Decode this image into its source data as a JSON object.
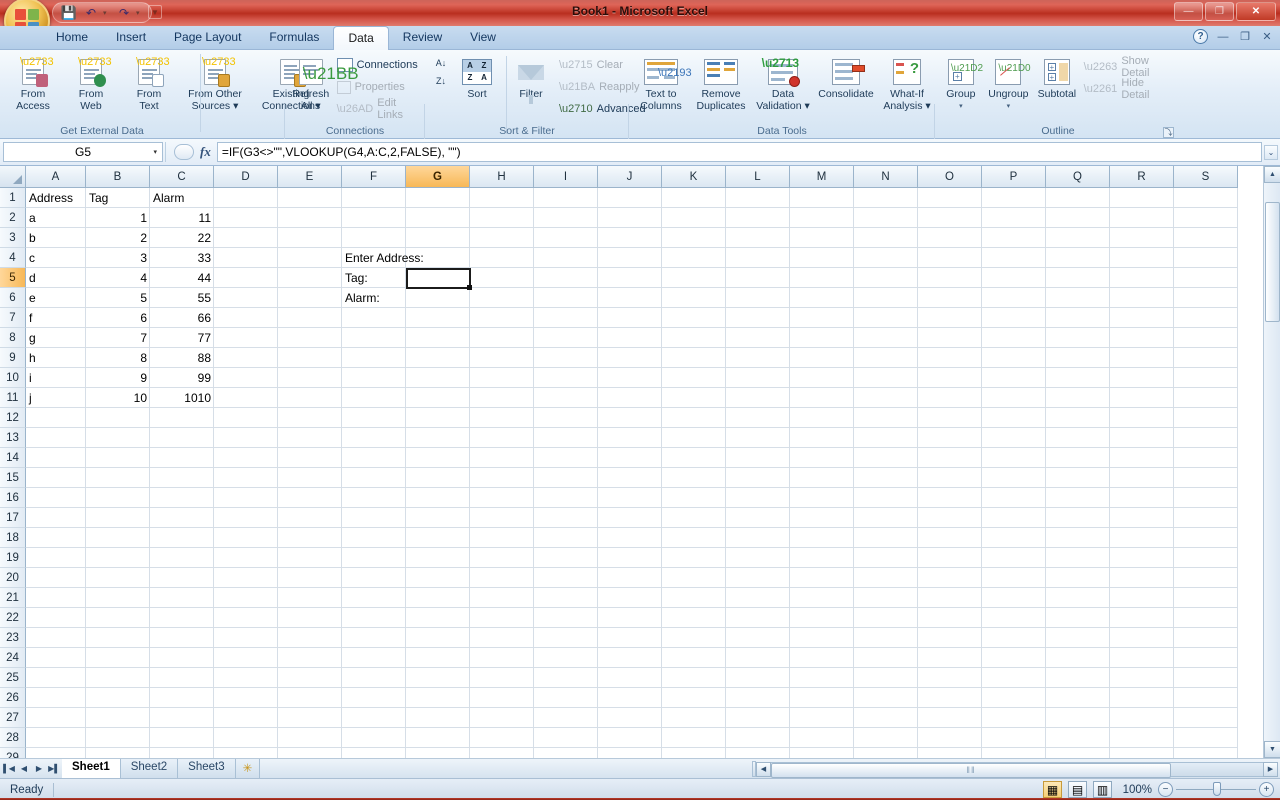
{
  "window": {
    "title": "Book1 - Microsoft Excel",
    "office_button": "office-orb",
    "quick_access": [
      {
        "name": "save",
        "glyph": "💾"
      },
      {
        "name": "undo",
        "glyph": "↶"
      },
      {
        "name": "redo",
        "glyph": "↷"
      }
    ],
    "qat_customize": "▼",
    "controls": {
      "minimize": "—",
      "restore": "❐",
      "close": "✕"
    }
  },
  "ribbon": {
    "tabs": [
      {
        "label": "Home",
        "active": false
      },
      {
        "label": "Insert",
        "active": false
      },
      {
        "label": "Page Layout",
        "active": false
      },
      {
        "label": "Formulas",
        "active": false
      },
      {
        "label": "Data",
        "active": true
      },
      {
        "label": "Review",
        "active": false
      },
      {
        "label": "View",
        "active": false
      }
    ],
    "help_glyph": "?",
    "doc_controls": {
      "minimize": "—",
      "restore": "❐",
      "close": "✕"
    },
    "groups": [
      {
        "name": "Get External Data",
        "label": "Get External Data",
        "buttons": [
          {
            "label_top": "From",
            "label_bottom": "Access"
          },
          {
            "label_top": "From",
            "label_bottom": "Web"
          },
          {
            "label_top": "From",
            "label_bottom": "Text"
          },
          {
            "label_top": "From Other",
            "label_bottom": "Sources ▾"
          }
        ]
      },
      {
        "name": "Existing Connections",
        "label": "",
        "buttons": [
          {
            "label_top": "Existing",
            "label_bottom": "Connections"
          }
        ]
      },
      {
        "name": "Connections",
        "label": "Connections",
        "refresh_top": "Refresh",
        "refresh_bottom": "All ▾",
        "items": [
          {
            "label": "Connections",
            "enabled": true
          },
          {
            "label": "Properties",
            "enabled": false
          },
          {
            "label": "Edit Links",
            "enabled": false
          }
        ]
      },
      {
        "name": "Sort & Filter",
        "label": "Sort & Filter",
        "sort_asc": "A↓",
        "sort_desc": "Z↓",
        "sort_label": "Sort",
        "filter_label": "Filter",
        "items": [
          {
            "label": "Clear",
            "enabled": false
          },
          {
            "label": "Reapply",
            "enabled": false
          },
          {
            "label": "Advanced",
            "enabled": true
          }
        ]
      },
      {
        "name": "Data Tools",
        "label": "Data Tools",
        "buttons": [
          {
            "label_top": "Text to",
            "label_bottom": "Columns"
          },
          {
            "label_top": "Remove",
            "label_bottom": "Duplicates"
          },
          {
            "label_top": "Data",
            "label_bottom": "Validation ▾"
          },
          {
            "label_top": "Consolidate",
            "label_bottom": ""
          },
          {
            "label_top": "What-If",
            "label_bottom": "Analysis ▾"
          }
        ]
      },
      {
        "name": "Outline",
        "label": "Outline",
        "buttons": [
          {
            "label_top": "Group",
            "label_bottom": "▾"
          },
          {
            "label_top": "Ungroup",
            "label_bottom": "▾"
          },
          {
            "label_top": "Subtotal",
            "label_bottom": ""
          }
        ],
        "items": [
          {
            "label": "Show Detail",
            "enabled": false
          },
          {
            "label": "Hide Detail",
            "enabled": false
          }
        ],
        "dialog_launcher": "⤵"
      }
    ]
  },
  "formula_bar": {
    "name_box_value": "G5",
    "name_box_caret": "▾",
    "fx_label": "fx",
    "formula": "=IF(G3<>\"\",VLOOKUP(G4,A:C,2,FALSE), \"\")",
    "expand_glyph": "⌄"
  },
  "grid": {
    "columns": [
      "A",
      "B",
      "C",
      "D",
      "E",
      "F",
      "G",
      "H",
      "I",
      "J",
      "K",
      "L",
      "M",
      "N",
      "O",
      "P",
      "Q",
      "R",
      "S"
    ],
    "selected_column": "G",
    "rows": [
      1,
      2,
      3,
      4,
      5,
      6,
      7,
      8,
      9,
      10,
      11,
      12,
      13,
      14,
      15,
      16,
      17,
      18,
      19,
      20,
      21,
      22,
      23,
      24,
      25,
      26,
      27,
      28,
      29
    ],
    "selected_row": 5,
    "selected_cell": "G5",
    "cells": [
      {
        "col": "A",
        "row": 1,
        "value": "Address",
        "align": "left"
      },
      {
        "col": "B",
        "row": 1,
        "value": "Tag",
        "align": "left"
      },
      {
        "col": "C",
        "row": 1,
        "value": "Alarm",
        "align": "left"
      },
      {
        "col": "A",
        "row": 2,
        "value": "a",
        "align": "left"
      },
      {
        "col": "B",
        "row": 2,
        "value": "1",
        "align": "right"
      },
      {
        "col": "C",
        "row": 2,
        "value": "11",
        "align": "right"
      },
      {
        "col": "A",
        "row": 3,
        "value": "b",
        "align": "left"
      },
      {
        "col": "B",
        "row": 3,
        "value": "2",
        "align": "right"
      },
      {
        "col": "C",
        "row": 3,
        "value": "22",
        "align": "right"
      },
      {
        "col": "A",
        "row": 4,
        "value": "c",
        "align": "left"
      },
      {
        "col": "B",
        "row": 4,
        "value": "3",
        "align": "right"
      },
      {
        "col": "C",
        "row": 4,
        "value": "33",
        "align": "right"
      },
      {
        "col": "A",
        "row": 5,
        "value": "d",
        "align": "left"
      },
      {
        "col": "B",
        "row": 5,
        "value": "4",
        "align": "right"
      },
      {
        "col": "C",
        "row": 5,
        "value": "44",
        "align": "right"
      },
      {
        "col": "A",
        "row": 6,
        "value": "e",
        "align": "left"
      },
      {
        "col": "B",
        "row": 6,
        "value": "5",
        "align": "right"
      },
      {
        "col": "C",
        "row": 6,
        "value": "55",
        "align": "right"
      },
      {
        "col": "A",
        "row": 7,
        "value": "f",
        "align": "left"
      },
      {
        "col": "B",
        "row": 7,
        "value": "6",
        "align": "right"
      },
      {
        "col": "C",
        "row": 7,
        "value": "66",
        "align": "right"
      },
      {
        "col": "A",
        "row": 8,
        "value": "g",
        "align": "left"
      },
      {
        "col": "B",
        "row": 8,
        "value": "7",
        "align": "right"
      },
      {
        "col": "C",
        "row": 8,
        "value": "77",
        "align": "right"
      },
      {
        "col": "A",
        "row": 9,
        "value": "h",
        "align": "left"
      },
      {
        "col": "B",
        "row": 9,
        "value": "8",
        "align": "right"
      },
      {
        "col": "C",
        "row": 9,
        "value": "88",
        "align": "right"
      },
      {
        "col": "A",
        "row": 10,
        "value": "i",
        "align": "left"
      },
      {
        "col": "B",
        "row": 10,
        "value": "9",
        "align": "right"
      },
      {
        "col": "C",
        "row": 10,
        "value": "99",
        "align": "right"
      },
      {
        "col": "A",
        "row": 11,
        "value": "j",
        "align": "left"
      },
      {
        "col": "B",
        "row": 11,
        "value": "10",
        "align": "right"
      },
      {
        "col": "C",
        "row": 11,
        "value": "1010",
        "align": "right"
      },
      {
        "col": "F",
        "row": 4,
        "value": "Enter Address:",
        "align": "left"
      },
      {
        "col": "F",
        "row": 5,
        "value": "Tag:",
        "align": "left"
      },
      {
        "col": "F",
        "row": 6,
        "value": "Alarm:",
        "align": "left"
      }
    ]
  },
  "sheet_tabs": {
    "nav": [
      "▌◀",
      "◀",
      "▶",
      "▶▌"
    ],
    "tabs": [
      {
        "label": "Sheet1",
        "active": true
      },
      {
        "label": "Sheet2",
        "active": false
      },
      {
        "label": "Sheet3",
        "active": false
      }
    ],
    "new_sheet_glyph": "✳"
  },
  "scrollbars": {
    "h_left": "◀",
    "h_right": "▶",
    "v_up": "▲",
    "v_down": "▼",
    "grip": "‖‖"
  },
  "status_bar": {
    "status": "Ready",
    "view_buttons": [
      {
        "name": "normal-view",
        "glyph": "▦",
        "active": true
      },
      {
        "name": "page-layout-view",
        "glyph": "▤",
        "active": false
      },
      {
        "name": "page-break-view",
        "glyph": "▥",
        "active": false
      }
    ],
    "zoom_level": "100%",
    "zoom_out": "−",
    "zoom_in": "+"
  }
}
